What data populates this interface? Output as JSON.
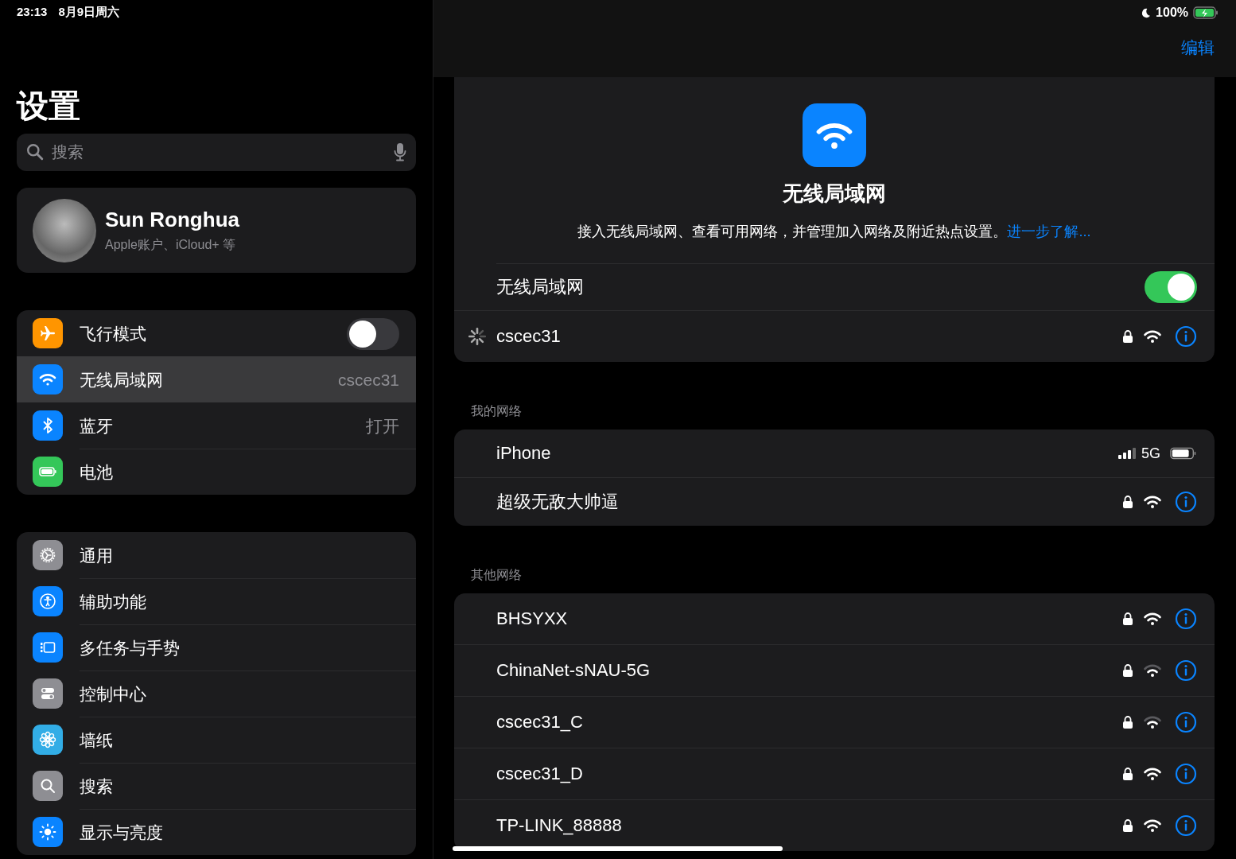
{
  "status_bar": {
    "time": "23:13",
    "date": "8月9日周六",
    "battery": "100%"
  },
  "sidebar": {
    "title": "设置",
    "search": {
      "placeholder": "搜索"
    },
    "profile": {
      "name": "Sun Ronghua",
      "subtitle": "Apple账户、iCloud+ 等"
    },
    "groups": [
      [
        {
          "color": "#ff9500",
          "label": "飞行模式",
          "kind": "toggle",
          "on": false,
          "selected": false
        },
        {
          "color": "#0a84ff",
          "label": "无线局域网",
          "kind": "value",
          "value": "cscec31",
          "selected": true
        },
        {
          "color": "#0a84ff",
          "label": "蓝牙",
          "kind": "value",
          "value": "打开",
          "selected": false
        },
        {
          "color": "#34c759",
          "label": "电池",
          "kind": "plain",
          "selected": false
        }
      ],
      [
        {
          "color": "#8e8e93",
          "label": "通用",
          "kind": "plain",
          "selected": false
        },
        {
          "color": "#0a84ff",
          "label": "辅助功能",
          "kind": "plain",
          "selected": false
        },
        {
          "color": "#0a84ff",
          "label": "多任务与手势",
          "kind": "plain",
          "selected": false
        },
        {
          "color": "#8e8e93",
          "label": "控制中心",
          "kind": "plain",
          "selected": false
        },
        {
          "color": "#32ade6",
          "label": "墙纸",
          "kind": "plain",
          "selected": false
        },
        {
          "color": "#8e8e93",
          "label": "搜索",
          "kind": "plain",
          "selected": false
        },
        {
          "color": "#0a84ff",
          "label": "显示与亮度",
          "kind": "plain",
          "selected": false
        }
      ]
    ]
  },
  "detail": {
    "edit": "编辑",
    "header": {
      "title": "无线局域网",
      "description": "接入无线局域网、查看可用网络，并管理加入网络及附近热点设置。",
      "link": "进一步了解..."
    },
    "wifi_toggle": {
      "label": "无线局域网",
      "on": true
    },
    "current": {
      "name": "cscec31"
    },
    "sections": [
      {
        "title": "我的网络",
        "networks": [
          {
            "kind": "hotspot",
            "name": "iPhone",
            "badge": "5G"
          },
          {
            "kind": "wifi",
            "name": "超级无敌大帅逼",
            "weak": false
          }
        ]
      },
      {
        "title": "其他网络",
        "networks": [
          {
            "kind": "wifi",
            "name": "BHSYXX",
            "weak": false
          },
          {
            "kind": "wifi",
            "name": "ChinaNet-sNAU-5G",
            "weak": true
          },
          {
            "kind": "wifi",
            "name": "cscec31_C",
            "weak": true
          },
          {
            "kind": "wifi",
            "name": "cscec31_D",
            "weak": false
          },
          {
            "kind": "wifi",
            "name": "TP-LINK_88888",
            "weak": false
          }
        ]
      }
    ]
  }
}
